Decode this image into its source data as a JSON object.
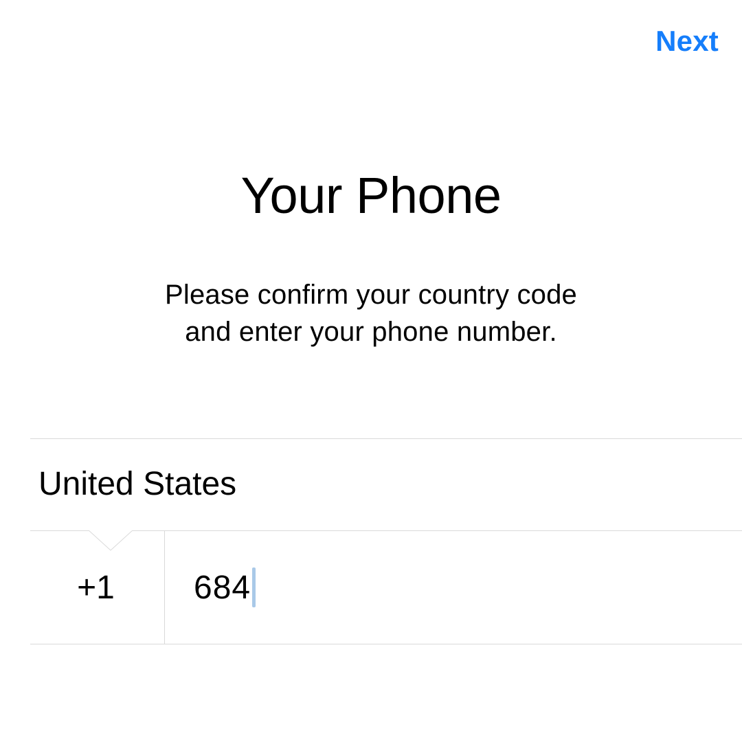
{
  "header": {
    "next_label": "Next"
  },
  "title": "Your Phone",
  "subtitle_line1": "Please confirm your country code",
  "subtitle_line2": "and enter your phone number.",
  "form": {
    "country_name": "United States",
    "country_code": "+1",
    "phone_value": "684"
  },
  "colors": {
    "accent": "#157efb",
    "divider": "#d9d9d9",
    "caret": "#a9c9e8"
  }
}
